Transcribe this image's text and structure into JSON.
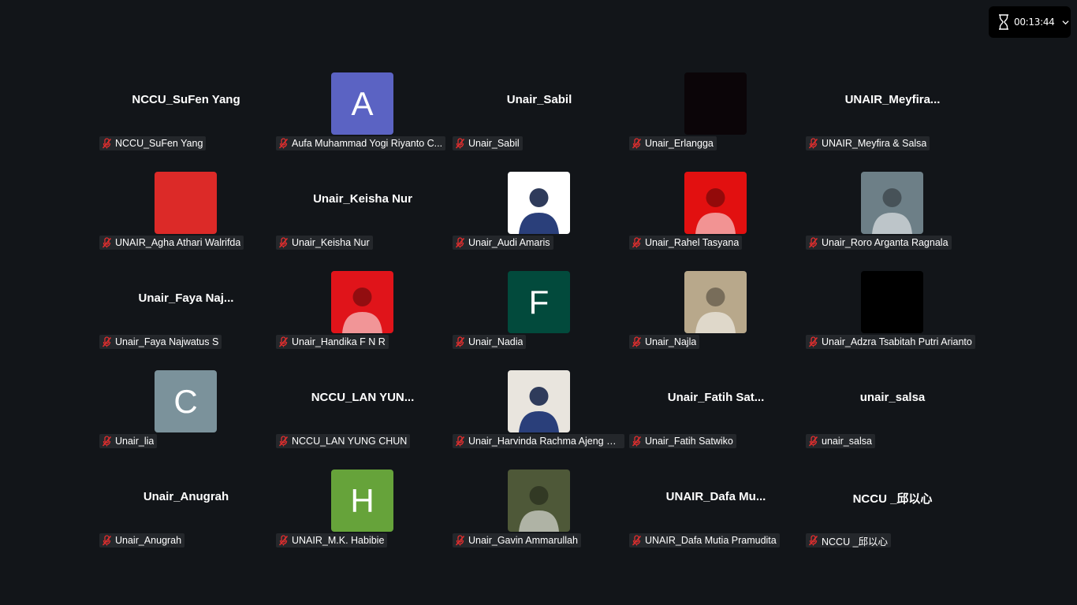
{
  "timer": {
    "time": "00:13:44"
  },
  "participants": [
    {
      "label": "NCCU_SuFen Yang",
      "display": "NCCU_SuFen Yang",
      "avatar": null
    },
    {
      "label": "Aufa Muhammad Yogi Riyanto C...",
      "display": "",
      "avatar": {
        "kind": "letter",
        "text": "A",
        "color": "#5b63c3"
      }
    },
    {
      "label": "Unair_Sabil",
      "display": "Unair_Sabil",
      "avatar": null
    },
    {
      "label": "Unair_Erlangga",
      "display": "",
      "avatar": {
        "kind": "photo",
        "text": "",
        "color": "#0b0508"
      }
    },
    {
      "label": "UNAIR_Meyfira & Salsa",
      "display": "UNAIR_Meyfira...",
      "avatar": null
    },
    {
      "label": "UNAIR_Agha Athari Walrifda",
      "display": "",
      "avatar": {
        "kind": "photo",
        "text": "",
        "color": "#dc2a28"
      }
    },
    {
      "label": "Unair_Keisha Nur",
      "display": "Unair_Keisha Nur",
      "avatar": null
    },
    {
      "label": "Unair_Audi Amaris",
      "display": "",
      "avatar": {
        "kind": "photo",
        "text": "",
        "color": "#ffffff"
      }
    },
    {
      "label": "Unair_Rahel Tasyana",
      "display": "",
      "avatar": {
        "kind": "photo",
        "text": "",
        "color": "#e21010"
      }
    },
    {
      "label": "Unair_Roro Arganta Ragnala",
      "display": "",
      "avatar": {
        "kind": "photo",
        "text": "",
        "color": "#6d7f87"
      }
    },
    {
      "label": "Unair_Faya Najwatus S",
      "display": "Unair_Faya  Naj...",
      "avatar": null
    },
    {
      "label": "Unair_Handika F N R",
      "display": "",
      "avatar": {
        "kind": "photo",
        "text": "",
        "color": "#e0141a"
      }
    },
    {
      "label": "Unair_Nadia",
      "display": "",
      "avatar": {
        "kind": "letter",
        "text": "F",
        "color": "#024a3c"
      }
    },
    {
      "label": "Unair_Najla",
      "display": "",
      "avatar": {
        "kind": "photo",
        "text": "",
        "color": "#b8a88b"
      }
    },
    {
      "label": "Unair_Adzra Tsabitah Putri Arianto",
      "display": "",
      "avatar": {
        "kind": "photo",
        "text": "",
        "color": "#000000"
      }
    },
    {
      "label": "Unair_lia",
      "display": "",
      "avatar": {
        "kind": "letter",
        "text": "C",
        "color": "#7b929b"
      }
    },
    {
      "label": "NCCU_LAN YUNG CHUN",
      "display": "NCCU_LAN  YUN...",
      "avatar": null
    },
    {
      "label": "Unair_Harvinda Rachma Ajeng Fi...",
      "display": "",
      "avatar": {
        "kind": "photo",
        "text": "",
        "color": "#e9e5de"
      }
    },
    {
      "label": "Unair_Fatih Satwiko",
      "display": "Unair_Fatih  Sat...",
      "avatar": null
    },
    {
      "label": "unair_salsa",
      "display": "unair_salsa",
      "avatar": null
    },
    {
      "label": "Unair_Anugrah",
      "display": "Unair_Anugrah",
      "avatar": null
    },
    {
      "label": "UNAIR_M.K. Habibie",
      "display": "",
      "avatar": {
        "kind": "letter",
        "text": "H",
        "color": "#66a33a"
      }
    },
    {
      "label": "Unair_Gavin Ammarullah",
      "display": "",
      "avatar": {
        "kind": "photo",
        "text": "",
        "color": "#4e5838"
      }
    },
    {
      "label": "UNAIR_Dafa Mutia Pramudita",
      "display": "UNAIR_Dafa  Mu...",
      "avatar": null
    },
    {
      "label": "NCCU _邱以心",
      "display": "NCCU _邱以心",
      "avatar": null
    }
  ]
}
